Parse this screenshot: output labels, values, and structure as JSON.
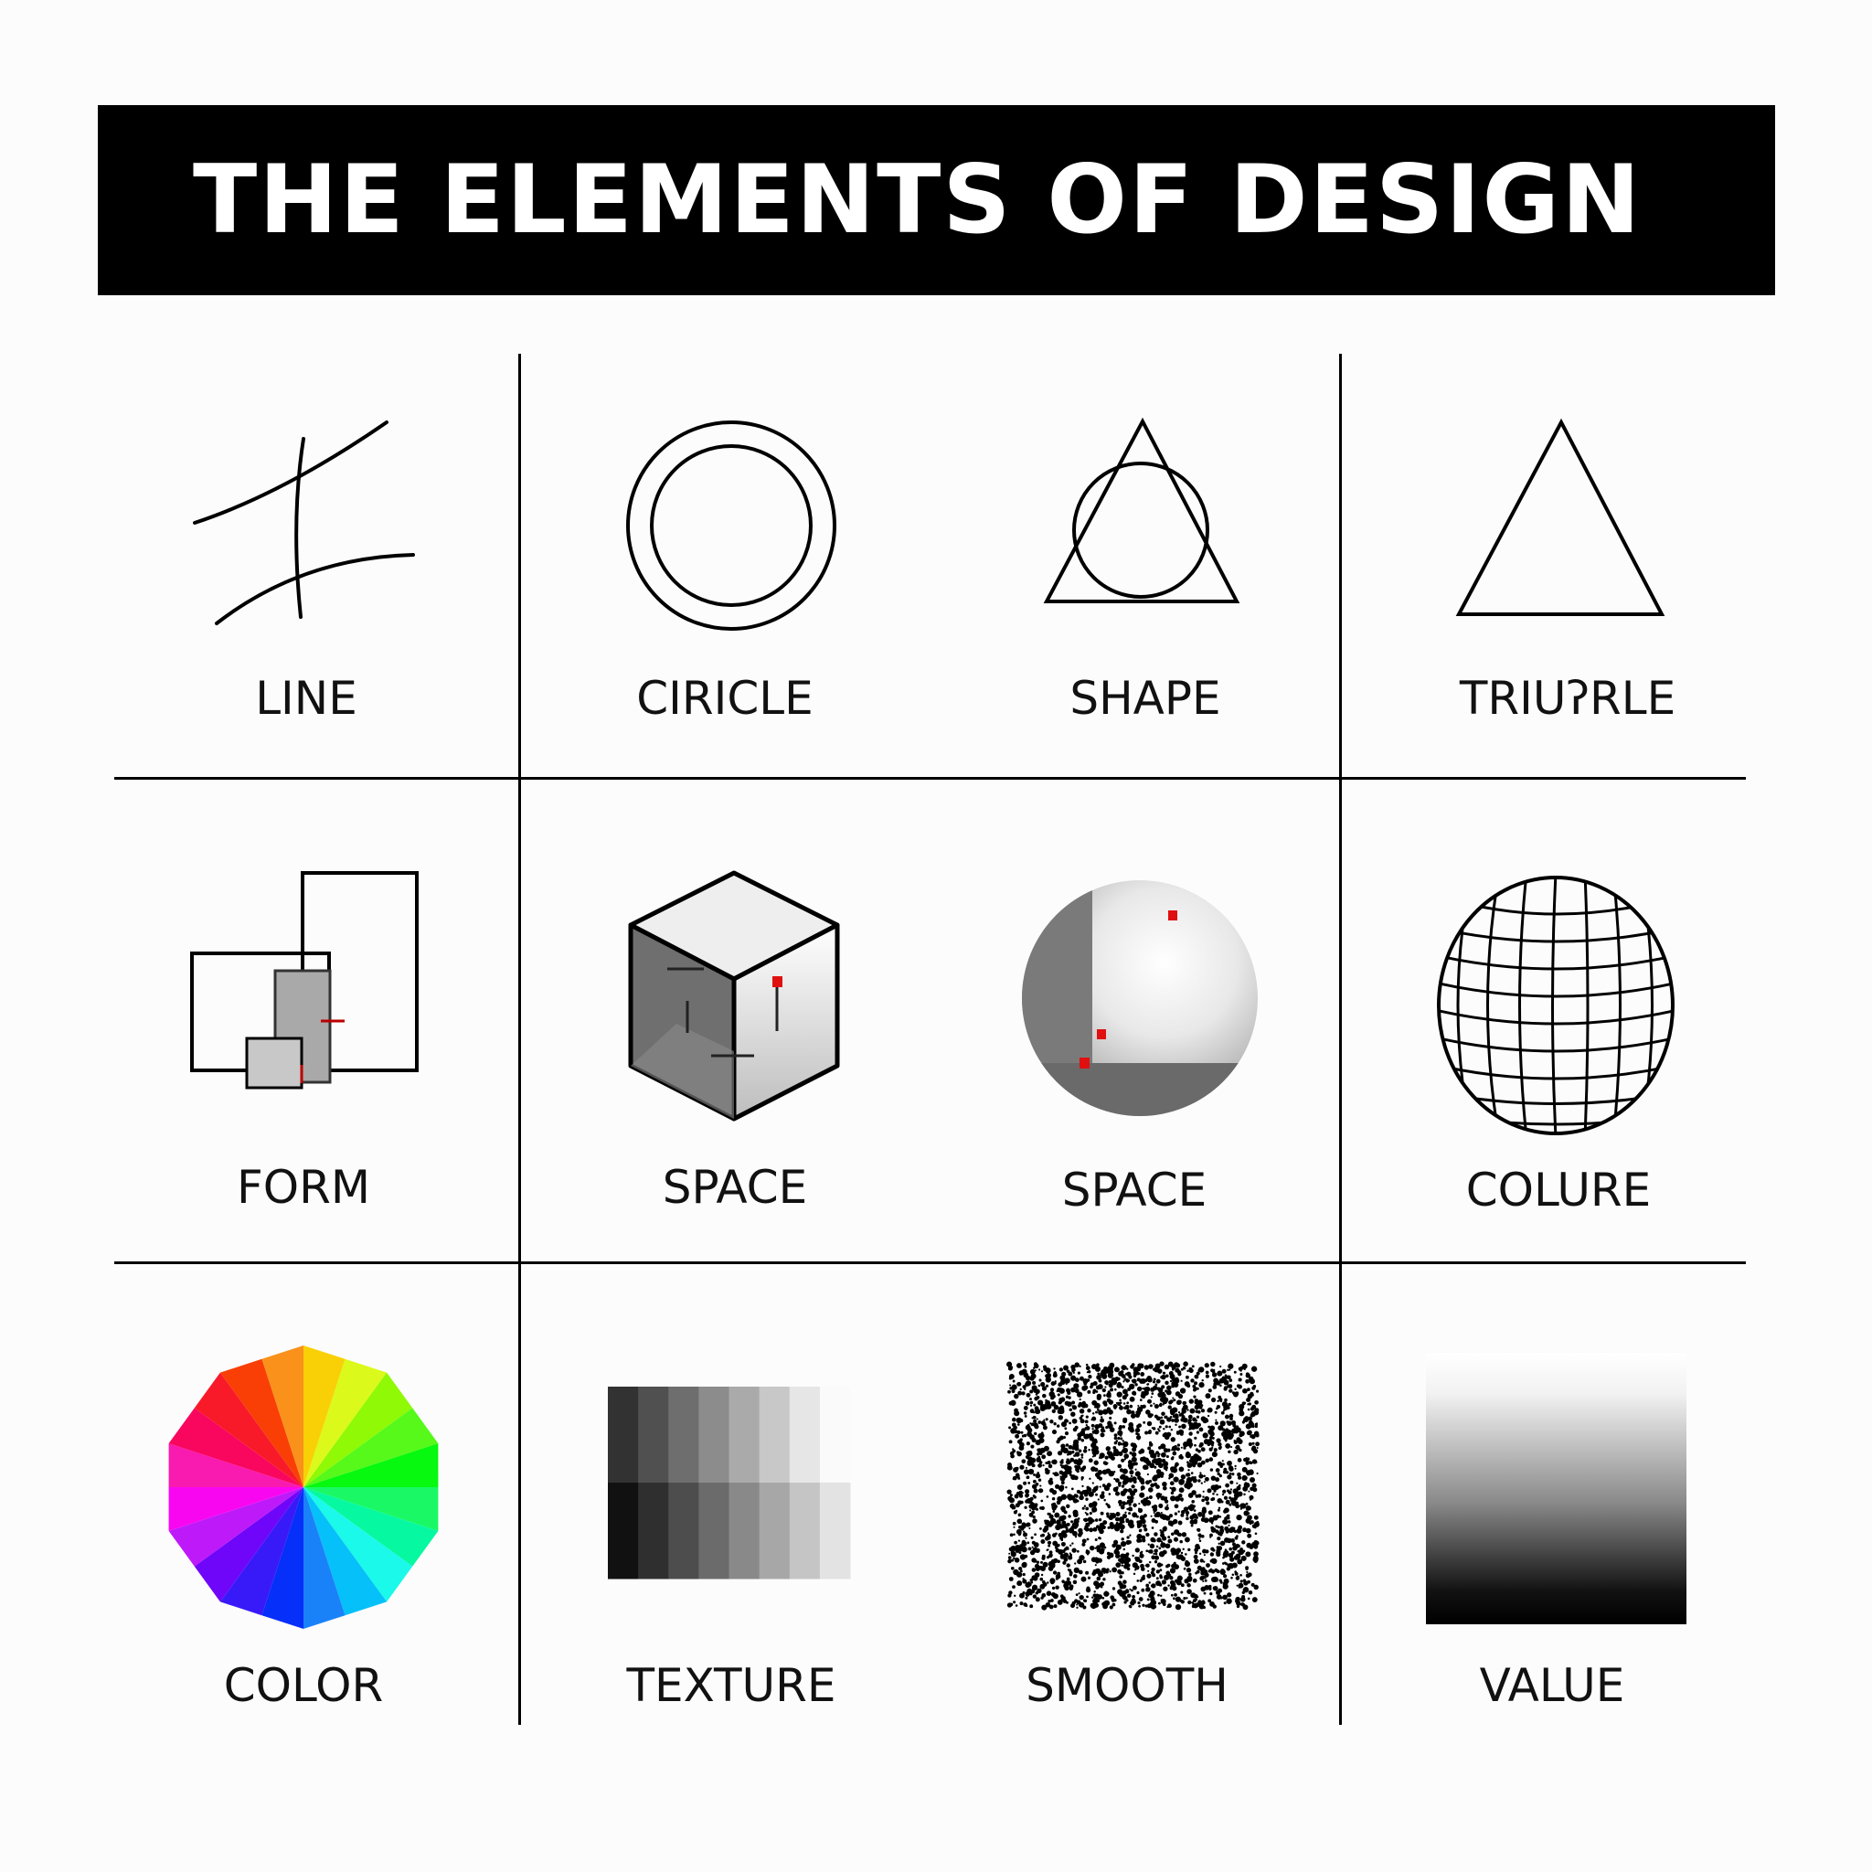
{
  "title": "THE ELEMENTS OF DESIGN",
  "colors": {
    "title_bg": "#000000",
    "title_fg": "#ffffff",
    "accent_red": "#e01010"
  },
  "cells": [
    {
      "label": "LINE",
      "icon": "crossing-lines-icon"
    },
    {
      "label": "CIRICLE",
      "icon": "ring-icon"
    },
    {
      "label": "SHAPE",
      "icon": "triangle-circle-icon"
    },
    {
      "label": "TRIUʔRLE",
      "icon": "triangle-icon"
    },
    {
      "label": "FORM",
      "icon": "overlapping-rectangles-icon"
    },
    {
      "label": "SPACE",
      "icon": "cube-icon"
    },
    {
      "label": "SPACE",
      "icon": "shaded-sphere-icon"
    },
    {
      "label": "COLURE",
      "icon": "wireframe-sphere-icon"
    },
    {
      "label": "COLOR",
      "icon": "color-wheel-icon"
    },
    {
      "label": "TEXTURE",
      "icon": "pixel-gradient-icon"
    },
    {
      "label": "SMOOTH",
      "icon": "stipple-texture-icon"
    },
    {
      "label": "VALUE",
      "icon": "value-gradient-icon"
    }
  ]
}
